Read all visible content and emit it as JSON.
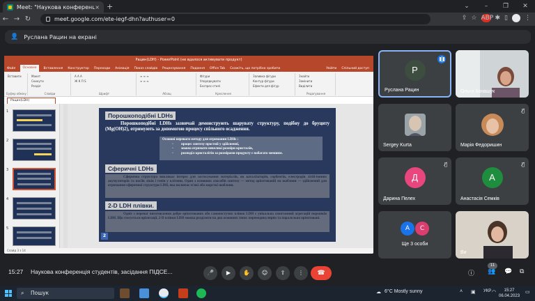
{
  "browser": {
    "tab_title": "Meet: \"Наукова конференц",
    "tab_close": "×",
    "new_tab": "+",
    "url": "meet.google.com/ete-iegf-dhn?authuser=0",
    "ext_label": "ABP"
  },
  "meet": {
    "presenting_banner": "Руслана Рацин на екрані",
    "meeting_time": "15:27",
    "meeting_title": "Наукова конференція студентів, засідання ПІДСЕ...",
    "participants_badge": "11"
  },
  "powerpoint": {
    "title": "Рацин(LDH) - PowerPoint (не вдалося активувати продукт)",
    "menu": [
      "Файл",
      "Основне",
      "Вставлення",
      "Конструктор",
      "Переходи",
      "Анімація",
      "Показ слайдів",
      "Рецензування",
      "Подання",
      "Office Tab",
      "Скажіть, що потрібно зробити"
    ],
    "user": "Увійти",
    "share": "Спільний доступ",
    "file_tab": "Рацин(LDH)",
    "status": "Слайд 3 з 14",
    "ribbon_groups": [
      {
        "label": "Буфер обміну",
        "lines": [
          "Вставити"
        ]
      },
      {
        "label": "Слайди",
        "lines": [
          "Макет",
          "Скинути",
          "Розділ"
        ]
      },
      {
        "label": "Шрифт",
        "lines": [
          "A A A",
          "Ж К П S"
        ]
      },
      {
        "label": "Абзац",
        "lines": [
          "≡ ≡ ≡",
          "≡ ≡ ≡"
        ]
      },
      {
        "label": "Креслення",
        "lines": [
          "Фігури",
          "Упорядкувати",
          "Експрес-стилі"
        ]
      },
      {
        "label": "",
        "lines": [
          "Заливка фігури",
          "Контур фігури",
          "Ефекти для фігур"
        ]
      },
      {
        "label": "Редагування",
        "lines": [
          "Знайти",
          "Замінити",
          "Виділити"
        ]
      }
    ]
  },
  "slide": {
    "number": "2",
    "h1": "Порошкоподібні LDHs",
    "p1": "Порошкоподібні LDHs зазвичай демонструють шарувату структуру, подібну до бруциту (Mg(OH)2), отримують за допомогою процесу спільного осадження.",
    "box_title": "Основні переваги методу для отримання LDHs :",
    "box_items": [
      "процес синтезу простий у здійсненні,",
      "можна отримати невеликі розміри кристалів,",
      "розподіл кристалітів за розмірами продукту є набагато меншим."
    ],
    "h2": "Сферичні LDHs",
    "p2": "Сферична структура викликає інтерес для застосування матеріалів, як каталізаторів, сорбентів, електродів літій-іонних акумуляторів та носіїв ліків і генів у клітини. Один з основних способів синтезу — метод орієнтованій на шаблони — здійснений для отримання сферичної структури LDH, яка включає м'які або жорсткі шаблони.",
    "h3": "2-D LDH плівки.",
    "p3": "Одніє з переваг виготовлення добре орієнтованих або самопостучих плівок LDH є унікальна спонтанний агрегацій порошків LDH. Що стосується орієнтації, 2-D плівки LDH можна розділити на два основних типи: перпендикулярно та паралельно орієнтовані."
  },
  "tiles": [
    {
      "name": "Руслана Рацин",
      "initial": "P",
      "color": "#3d4d3f",
      "kind": "avatar"
    },
    {
      "name": "Ольга Конашук",
      "kind": "photo"
    },
    {
      "name": "Sergey Kurta",
      "kind": "photo"
    },
    {
      "name": "Марія Федоришин",
      "kind": "photo"
    },
    {
      "name": "Дарина Пелех",
      "initial": "Д",
      "color": "#e8467c",
      "kind": "avatar"
    },
    {
      "name": "Анастасія Семків",
      "initial": "А",
      "color": "#1e8e3e",
      "kind": "avatar"
    },
    {
      "name": "Ще 3 особи",
      "kind": "group",
      "initials": [
        "А",
        "С"
      ],
      "colors": [
        "#1a73e8",
        "#d93e6e"
      ]
    },
    {
      "name": "Ви",
      "kind": "photo"
    }
  ],
  "taskbar": {
    "search": "Пошук",
    "weather": "6°C  Mostly sunny",
    "lang": "УКР",
    "time": "15:27",
    "date": "06.04.2023"
  }
}
